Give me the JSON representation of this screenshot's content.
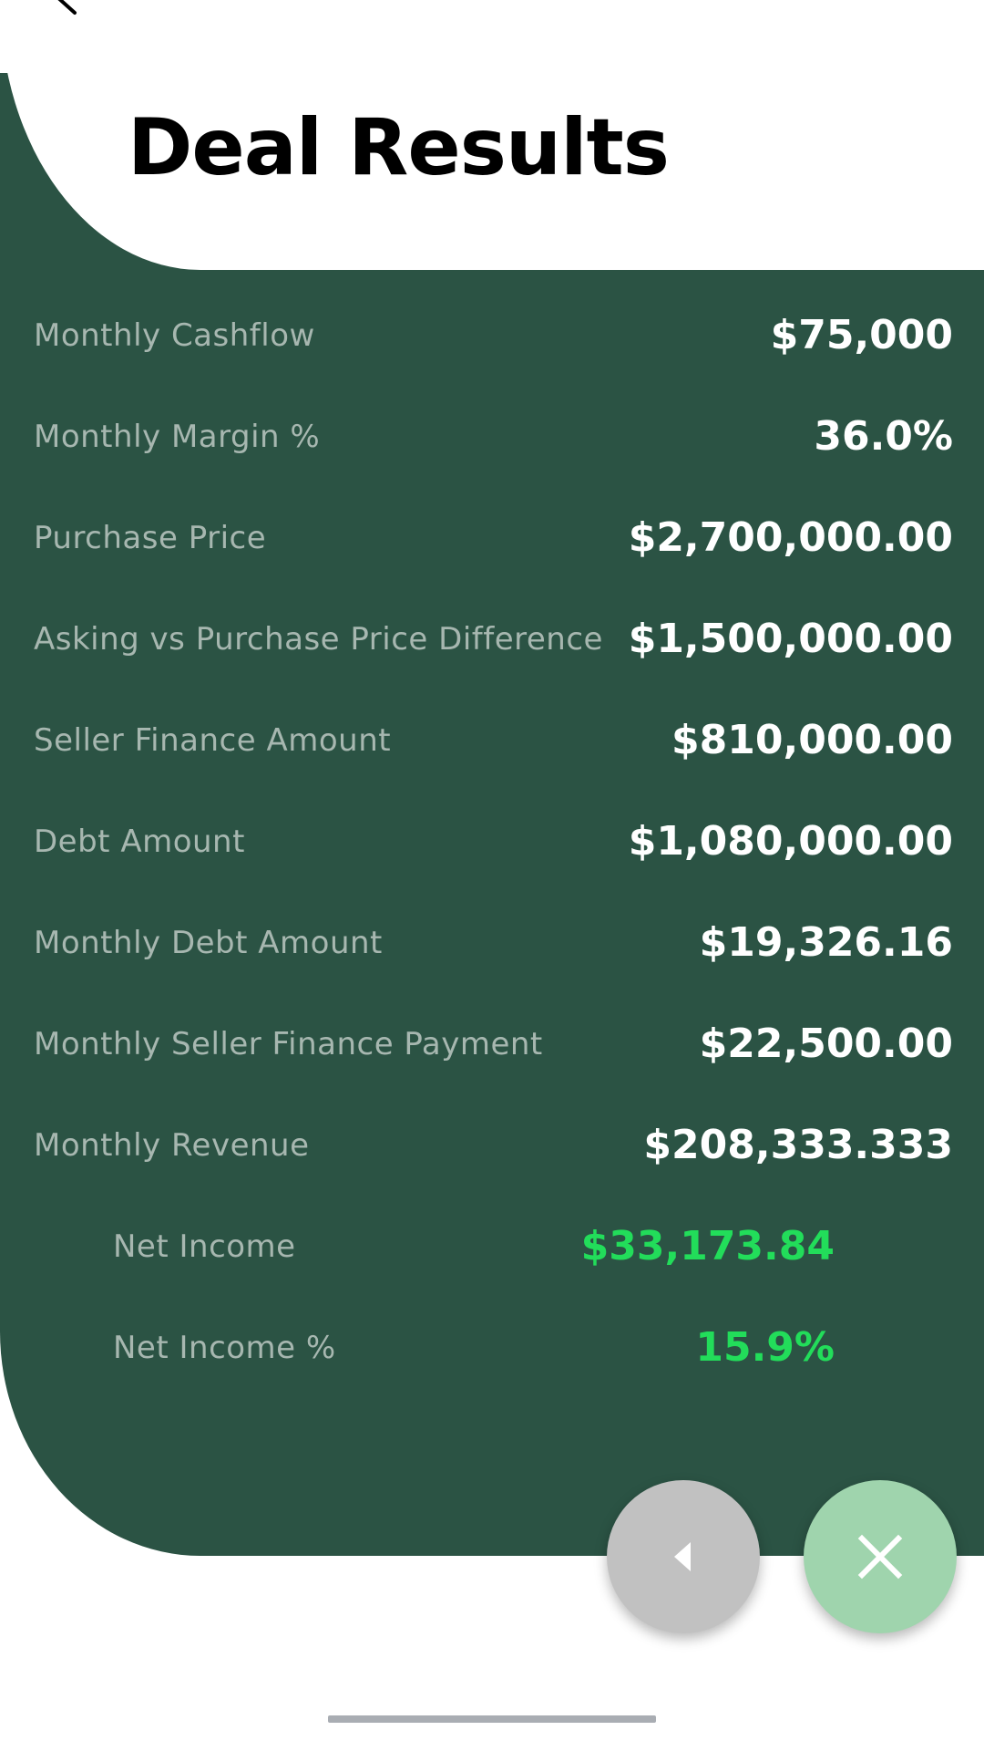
{
  "header": {
    "title": "Deal Results"
  },
  "results": [
    {
      "label": "Monthly Cashflow",
      "value": "$75,000"
    },
    {
      "label": "Monthly Margin %",
      "value": "36.0%"
    },
    {
      "label": "Purchase Price",
      "value": "$2,700,000.00"
    },
    {
      "label": "Asking vs Purchase Price Difference",
      "value": "$1,500,000.00"
    },
    {
      "label": "Seller Finance Amount",
      "value": "$810,000.00"
    },
    {
      "label": "Debt Amount",
      "value": "$1,080,000.00"
    },
    {
      "label": "Monthly Debt Amount",
      "value": "$19,326.16"
    },
    {
      "label": "Monthly Seller Finance Payment",
      "value": "$22,500.00"
    },
    {
      "label": "Monthly Revenue",
      "value": "$208,333.333"
    }
  ],
  "net": [
    {
      "label": "Net Income",
      "value": "$33,173.84"
    },
    {
      "label": "Net Income %",
      "value": "15.9%"
    }
  ],
  "actions": {
    "back_icon": "triangle-left-icon",
    "close_icon": "close-icon"
  },
  "colors": {
    "panel": "#2b5344",
    "label": "#a7b7b0",
    "value": "#ffffff",
    "positive": "#22dd5a",
    "back_button": "#c1c1c1",
    "close_button": "#9fd4ad"
  }
}
